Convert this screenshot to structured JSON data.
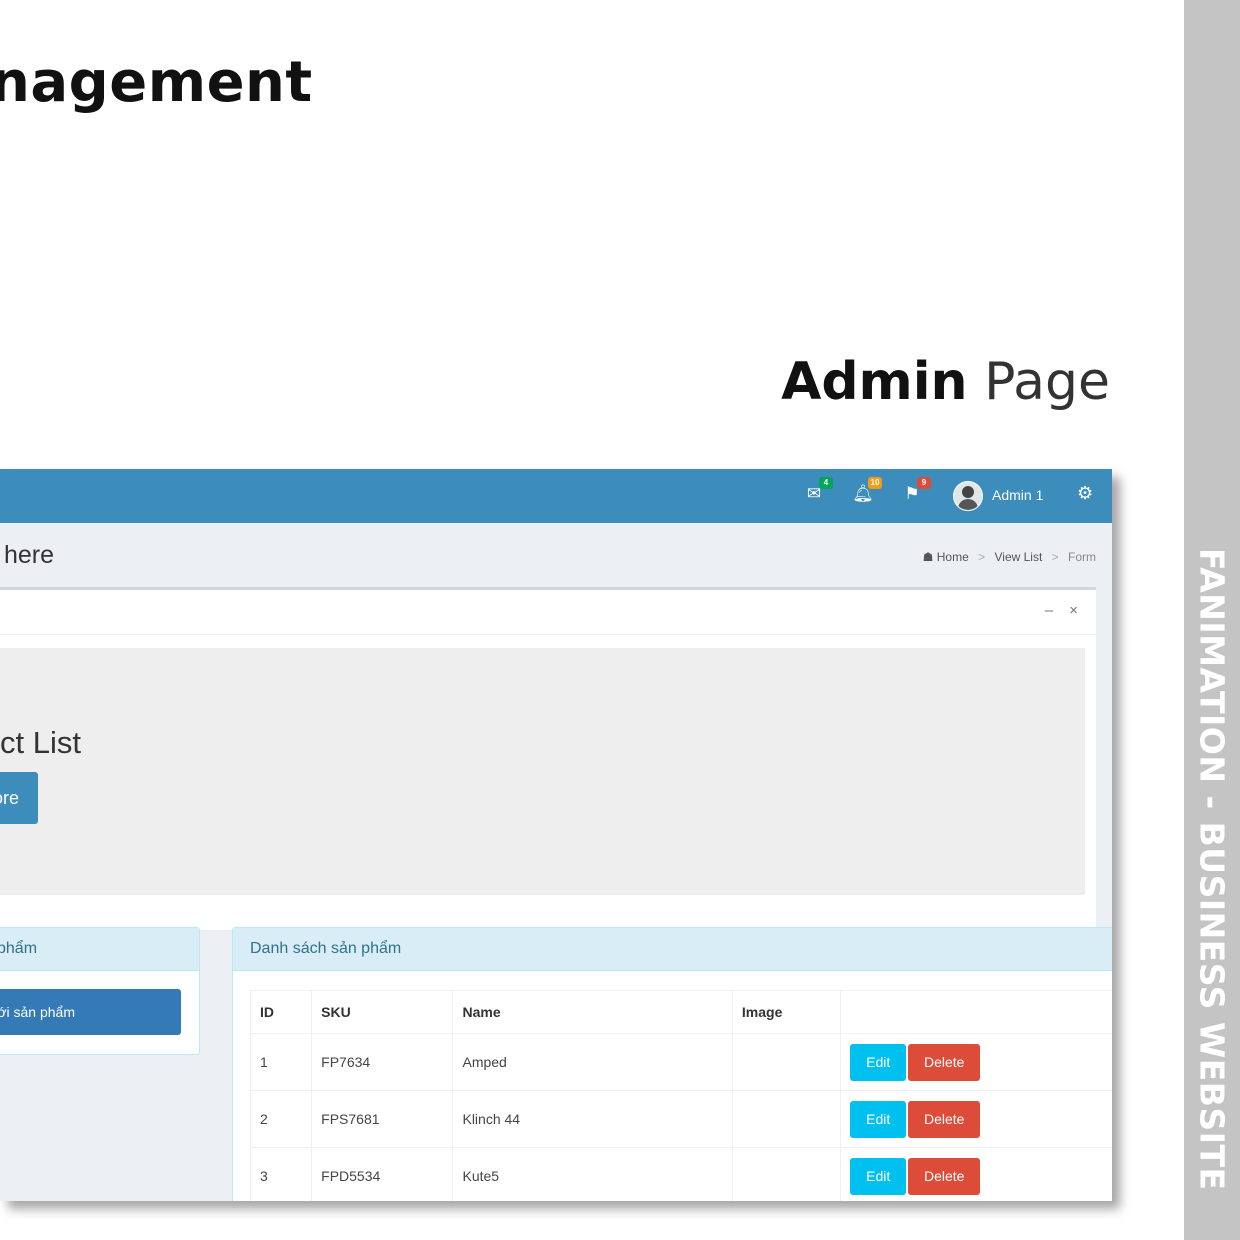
{
  "slide": {
    "title_fragment": "nagement",
    "section_title_bold": "Admin",
    "section_title_light": "Page",
    "side_label": "FANIMATION - BUSINESS WEBSITE"
  },
  "topbar": {
    "messages_badge": "4",
    "notifications_badge": "10",
    "tasks_badge": "9",
    "user_name": "Admin 1",
    "colors": {
      "bar": "#3c8dbc",
      "messages_badge": "#00a65a",
      "notifications_badge": "#f39c12",
      "tasks_badge": "#dd4b39"
    }
  },
  "content_header": {
    "title_fragment": "here",
    "breadcrumb": [
      "Home",
      "View List",
      "Form"
    ]
  },
  "box": {
    "tools": [
      "–",
      "×"
    ],
    "jumbotron_title_fragment": "ct List",
    "jumbotron_button_fragment": "ore"
  },
  "left_panel": {
    "title_fragment": "phẩm",
    "add_button_fragment": "ới sản phẩm"
  },
  "right_panel": {
    "title": "Danh sách sản phẩm",
    "columns": [
      "ID",
      "SKU",
      "Name",
      "Image",
      ""
    ],
    "rows": [
      {
        "id": "1",
        "sku": "FP7634",
        "name": "Amped",
        "image": ""
      },
      {
        "id": "2",
        "sku": "FPS7681",
        "name": "Klinch 44",
        "image": ""
      },
      {
        "id": "3",
        "sku": "FPD5534",
        "name": "Kute5",
        "image": ""
      }
    ],
    "edit_label": "Edit",
    "delete_label": "Delete"
  }
}
